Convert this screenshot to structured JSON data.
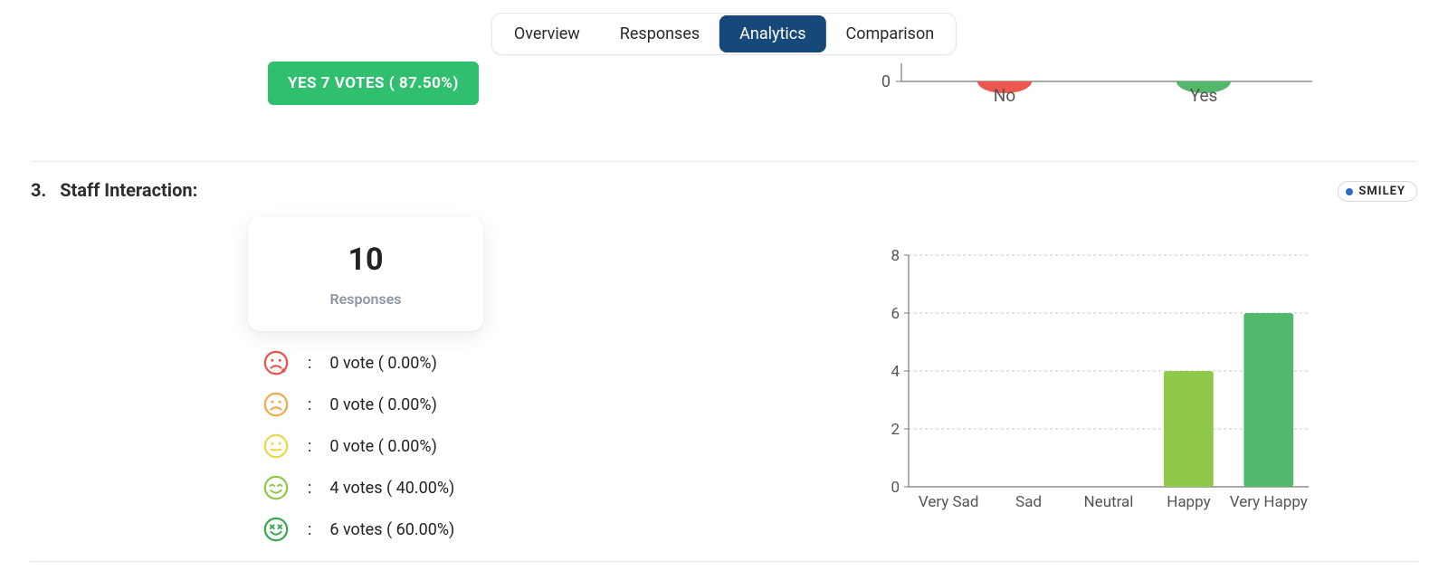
{
  "tabs": {
    "overview": "Overview",
    "responses": "Responses",
    "analytics": "Analytics",
    "comparison": "Comparison",
    "active": "analytics"
  },
  "yes_chip": "YES 7 VOTES ( 87.50%)",
  "mini_chart": {
    "zero_label": "0",
    "categories": [
      "No",
      "Yes"
    ],
    "colors": [
      "#ee574e",
      "#52b96c"
    ]
  },
  "section": {
    "number": "3.",
    "title": "Staff Interaction:"
  },
  "smiley_tag": "SMILEY",
  "responses_card": {
    "count": "10",
    "label": "Responses"
  },
  "votes": [
    {
      "mood": "very_sad",
      "color": "#e8534a",
      "text": "0 vote ( 0.00%)"
    },
    {
      "mood": "sad",
      "color": "#f2a84b",
      "text": "0 vote ( 0.00%)"
    },
    {
      "mood": "neutral",
      "color": "#e7d84c",
      "text": "0 vote ( 0.00%)"
    },
    {
      "mood": "happy",
      "color": "#8fc94a",
      "text": "4 votes ( 40.00%)"
    },
    {
      "mood": "very_happy",
      "color": "#3aa84f",
      "text": "6 votes ( 60.00%)"
    }
  ],
  "chart_data": {
    "type": "bar",
    "categories": [
      "Very Sad",
      "Sad",
      "Neutral",
      "Happy",
      "Very Happy"
    ],
    "values": [
      0,
      0,
      0,
      4,
      6
    ],
    "colors": [
      "#e8534a",
      "#f2a84b",
      "#e7d84c",
      "#8fc94a",
      "#52b96c"
    ],
    "ylim": [
      0,
      8
    ],
    "yticks": [
      0,
      2,
      4,
      6,
      8
    ],
    "ylabel": "",
    "xlabel": "",
    "title": ""
  }
}
